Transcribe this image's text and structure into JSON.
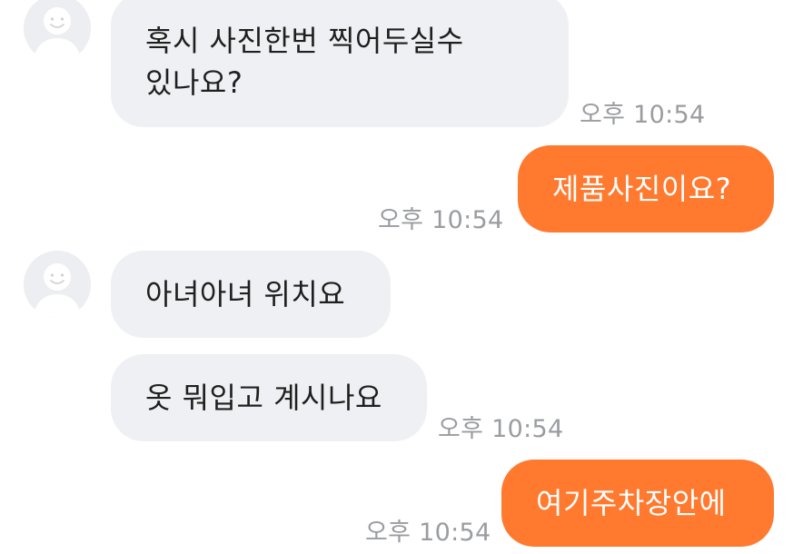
{
  "theme": {
    "incoming_bubble_color": "#eef0f3",
    "outgoing_bubble_color": "#ff7a2f",
    "timestamp_color": "#9a9ca0"
  },
  "messages": [
    {
      "side": "incoming",
      "lines": [
        "혹시 사진한번 찍어두실수",
        "있나요?"
      ],
      "time": "오후 10:54",
      "avatar": "user-avatar-icon"
    },
    {
      "side": "outgoing",
      "text": "제품사진이요?",
      "time": "오후 10:54"
    },
    {
      "side": "incoming",
      "text": "아녀아녀 위치요",
      "avatar": "user-avatar-icon"
    },
    {
      "side": "incoming",
      "text": "옷 뭐입고 계시나요",
      "time": "오후 10:54"
    },
    {
      "side": "outgoing",
      "text": "여기주차장안에",
      "time": "오후 10:54"
    }
  ]
}
